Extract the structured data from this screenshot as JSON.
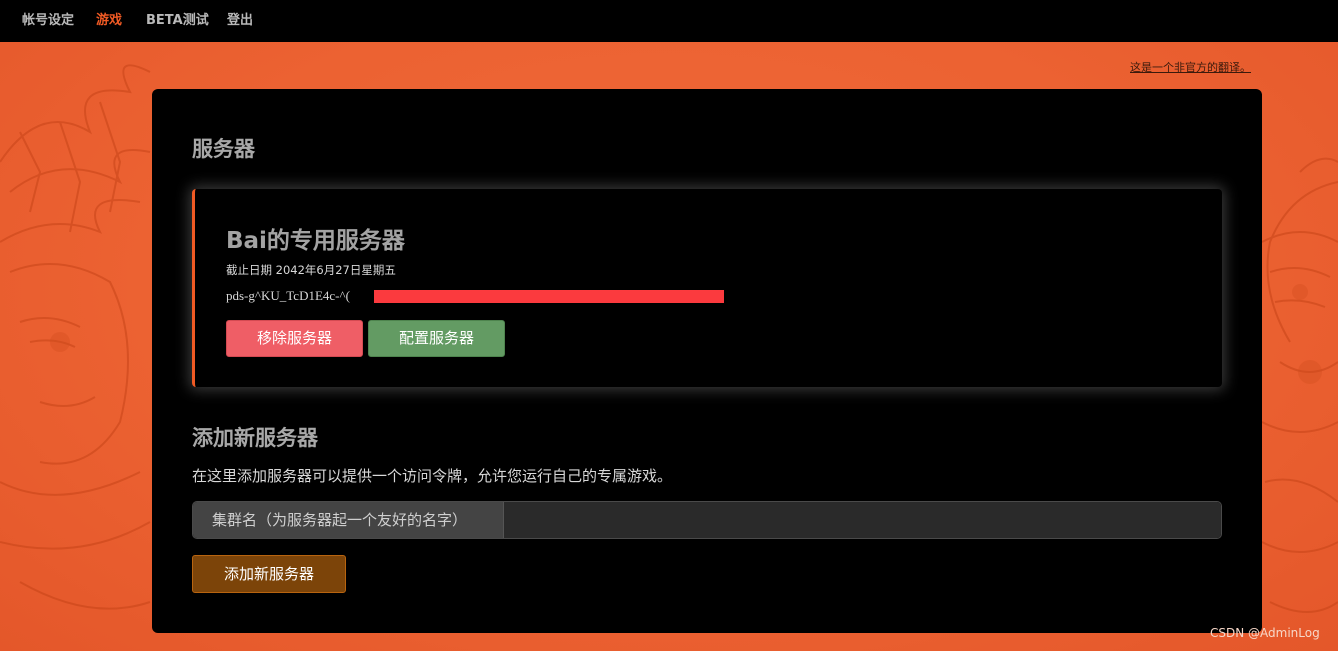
{
  "nav": {
    "items": [
      {
        "label": "帐号设定"
      },
      {
        "label": "游戏"
      },
      {
        "label": "BETA测试"
      },
      {
        "label": "登出"
      }
    ],
    "active_index": 1
  },
  "translation_note": "这是一个非官方的翻译。",
  "servers_section": {
    "title": "服务器",
    "server": {
      "name": "Bai的专用服务器",
      "expiry": "截止日期 2042年6月27日星期五",
      "token": "pds-g^KU_TcD1E4c-^(",
      "redact_color": "#fb3a3e",
      "remove_label": "移除服务器",
      "config_label": "配置服务器"
    }
  },
  "add_section": {
    "title": "添加新服务器",
    "description": "在这里添加服务器可以提供一个访问令牌，允许您运行自己的专属游戏。",
    "cluster_label": "集群名（为服务器起一个友好的名字）",
    "cluster_value": "",
    "cluster_placeholder": "",
    "add_button_label": "添加新服务器"
  },
  "watermark": "CSDN @AdminLog",
  "colors": {
    "accent": "#f05a24",
    "background": "#e95f2c",
    "remove": "#ef5e66",
    "config": "#639b63",
    "add": "#7c4409"
  }
}
